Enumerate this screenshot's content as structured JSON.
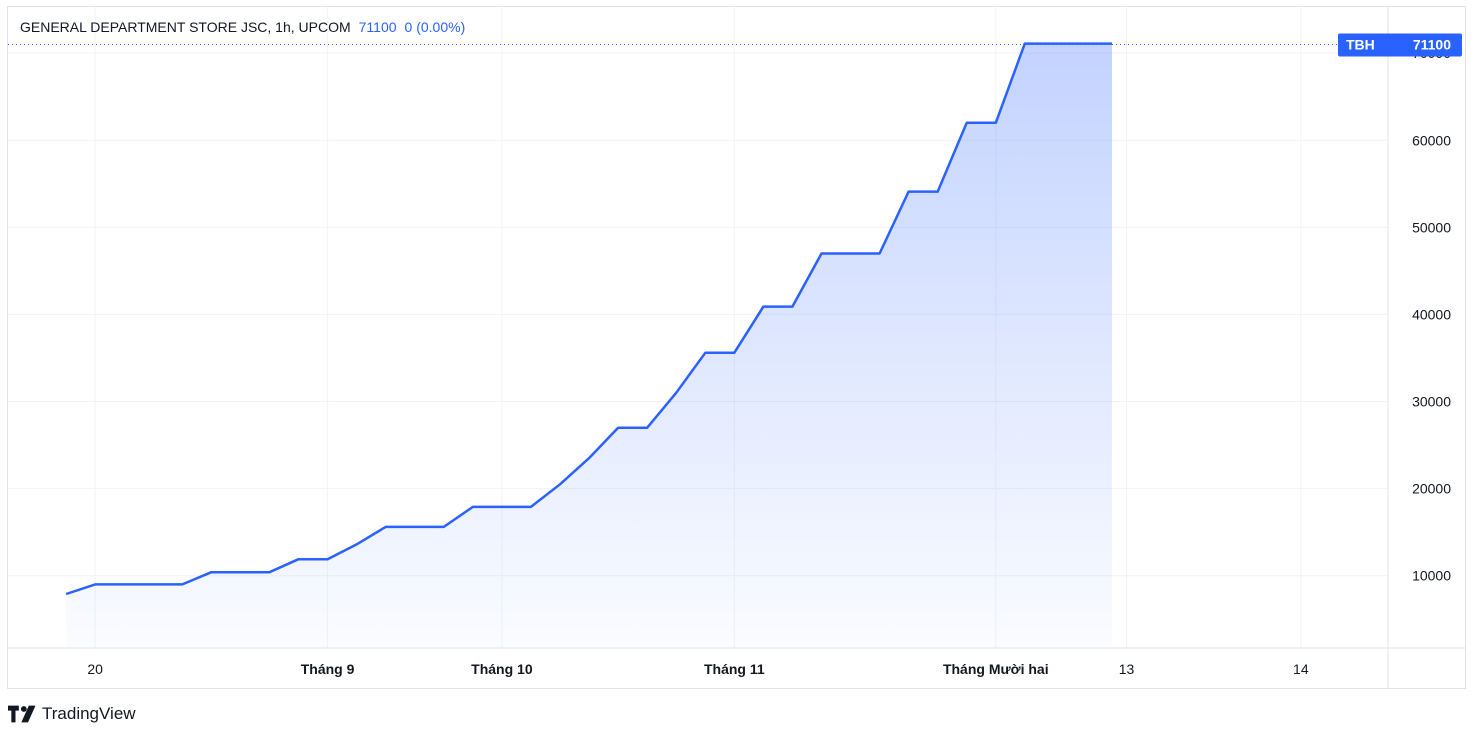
{
  "header": {
    "symbol_title": "GENERAL DEPARTMENT STORE JSC, 1h, UPCOM",
    "last_price": "71100",
    "change": "0 (0.00%)"
  },
  "price_tag": {
    "ticker": "TBH",
    "value": "71100"
  },
  "footer": {
    "brand": "TradingView"
  },
  "colors": {
    "line": "#2962ff",
    "tag_bg": "#2962ff",
    "grid": "#f0f3fa",
    "border": "#e0e3eb"
  },
  "chart_data": {
    "type": "area",
    "title": "GENERAL DEPARTMENT STORE JSC, 1h, UPCOM",
    "xlabel": "",
    "ylabel": "",
    "ylim": [
      1700,
      75300
    ],
    "y_ticks": [
      10000,
      20000,
      30000,
      40000,
      50000,
      60000,
      70000
    ],
    "y_tick_labels": [
      "10000",
      "20000",
      "30000",
      "40000",
      "50000",
      "60000",
      "70000"
    ],
    "x_ticks": [
      {
        "label": "20",
        "pos": 1.0,
        "bold": false
      },
      {
        "label": "Tháng 9",
        "pos": 9.0,
        "bold": true
      },
      {
        "label": "Tháng 10",
        "pos": 15.0,
        "bold": true
      },
      {
        "label": "Tháng 11",
        "pos": 23.0,
        "bold": true
      },
      {
        "label": "Tháng Mười hai",
        "pos": 32.0,
        "bold": true
      },
      {
        "label": "13",
        "pos": 36.5,
        "bold": false
      },
      {
        "label": "14",
        "pos": 42.5,
        "bold": false
      }
    ],
    "x_range": [
      -2.0,
      45.5
    ],
    "grid": true,
    "series": [
      {
        "x": [
          0,
          1,
          2,
          3,
          4,
          5,
          6,
          7,
          8,
          9,
          10,
          11,
          12,
          13,
          14,
          15,
          16,
          17,
          18,
          19,
          20,
          21,
          22,
          23,
          24,
          25,
          26,
          27,
          28,
          29,
          30,
          31,
          32,
          33,
          34,
          35,
          36
        ],
        "values": [
          7900,
          9000,
          9000,
          9000,
          9000,
          10400,
          10400,
          10400,
          11900,
          11900,
          13600,
          15600,
          15600,
          15600,
          17900,
          17900,
          17900,
          20500,
          23500,
          27000,
          27000,
          31000,
          35600,
          35600,
          40900,
          40900,
          47000,
          47000,
          47000,
          54100,
          54100,
          62000,
          62000,
          71100,
          71100,
          71100,
          71100
        ]
      }
    ]
  }
}
